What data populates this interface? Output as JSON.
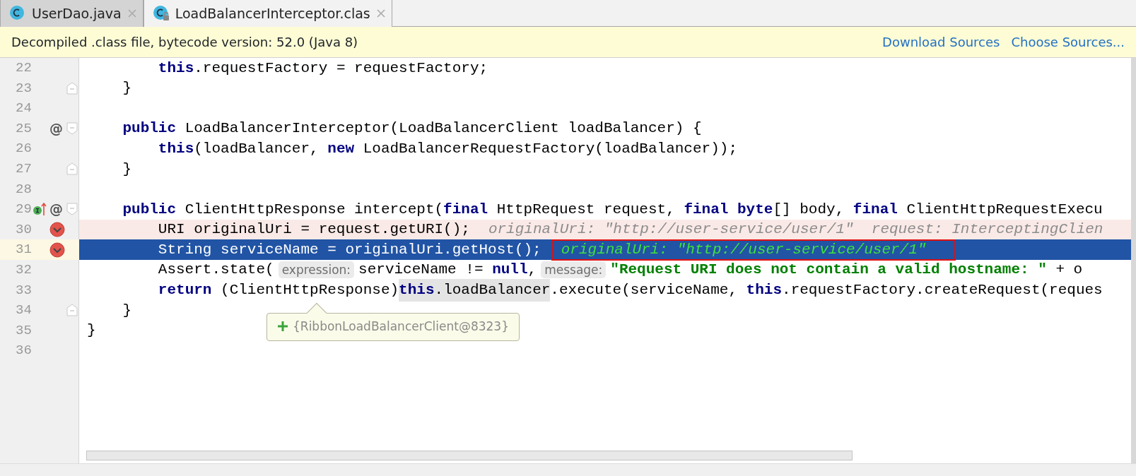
{
  "tabs": [
    {
      "label": "UserDao.java",
      "selected": false,
      "locked": false
    },
    {
      "label": "LoadBalancerInterceptor.clas",
      "selected": true,
      "locked": true
    }
  ],
  "banner": {
    "message": "Decompiled .class file, bytecode version: 52.0 (Java 8)",
    "links": [
      "Download Sources",
      "Choose Sources..."
    ]
  },
  "lines": [
    {
      "number": "22",
      "implements": false,
      "breakpoint": false,
      "current": false,
      "tokens": [
        {
          "kind": "code",
          "text": "        **this**.requestFactory = requestFactory;"
        }
      ]
    },
    {
      "number": "23",
      "fold": {
        "kind": "end"
      },
      "implements": false,
      "breakpoint": false,
      "current": false,
      "tokens": [
        {
          "kind": "code",
          "text": "    }"
        }
      ]
    },
    {
      "number": "24",
      "implements": false,
      "breakpoint": false,
      "current": false
    },
    {
      "number": "25",
      "fold": {
        "kind": "start"
      },
      "annotation": "@",
      "implements": false,
      "breakpoint": false,
      "current": false,
      "tokens": [
        {
          "kind": "code",
          "text": "    **public** LoadBalancerInterceptor(LoadBalancerClient loadBalancer) {"
        }
      ]
    },
    {
      "number": "26",
      "implements": false,
      "breakpoint": false,
      "current": false,
      "tokens": [
        {
          "kind": "code",
          "text": "        **this**(loadBalancer, **new** LoadBalancerRequestFactory(loadBalancer));"
        }
      ]
    },
    {
      "number": "27",
      "fold": {
        "kind": "end"
      },
      "implements": false,
      "breakpoint": false,
      "current": false,
      "tokens": [
        {
          "kind": "code",
          "text": "    }"
        }
      ]
    },
    {
      "number": "28",
      "implements": false,
      "breakpoint": false,
      "current": false
    },
    {
      "number": "29",
      "fold": {
        "kind": "start"
      },
      "annotation": "@",
      "implements": true,
      "breakpoint": false,
      "current": false,
      "tokens": [
        {
          "kind": "code",
          "text": "    **public** ClientHttpResponse intercept(**final** HttpRequest request, **final** **byte**[] body, **final** ClientHttpRequestExecu"
        }
      ]
    },
    {
      "number": "30",
      "implements": false,
      "breakpoint": true,
      "current": false,
      "tokens": [
        {
          "kind": "code",
          "text": "        URI originalUri = request.getURI();"
        },
        {
          "kind": "value",
          "text": "originalUri: \"http://user-service/user/1\"  request: InterceptingClien"
        }
      ]
    },
    {
      "number": "31",
      "implements": false,
      "breakpoint": true,
      "current": true,
      "tokens": [
        {
          "kind": "code",
          "text": "        String serviceName = originalUri.getHost();"
        },
        {
          "kind": "value_boxed",
          "text": "originalUri: \"http://user-service/user/1\""
        }
      ]
    },
    {
      "number": "32",
      "implements": false,
      "breakpoint": false,
      "current": false,
      "tokens": [
        {
          "kind": "code",
          "text": "        Assert.state("
        },
        {
          "kind": "inlay",
          "text": "expression:"
        },
        {
          "kind": "code",
          "text": "serviceName != **null**,"
        },
        {
          "kind": "inlay",
          "text": "message:"
        },
        {
          "kind": "string",
          "text": "\"Request URI does not contain a valid hostname: \""
        },
        {
          "kind": "code",
          "text": " + o"
        }
      ]
    },
    {
      "number": "33",
      "implements": false,
      "breakpoint": false,
      "current": false,
      "tokens": [
        {
          "kind": "code",
          "text": "        **return** (ClientHttpResponse)"
        },
        {
          "kind": "highlight",
          "text": "**this**.loadBalancer"
        },
        {
          "kind": "code",
          "text": ".execute(serviceName, **this**.requestFactory.createRequest(reques"
        }
      ]
    },
    {
      "number": "34",
      "fold": {
        "kind": "end"
      },
      "implements": false,
      "breakpoint": false,
      "current": false,
      "tokens": [
        {
          "kind": "code",
          "text": "    }"
        }
      ]
    },
    {
      "number": "35",
      "implements": false,
      "breakpoint": false,
      "current": false,
      "tokens": [
        {
          "kind": "code",
          "text": "}"
        }
      ]
    },
    {
      "number": "36",
      "implements": false,
      "breakpoint": false,
      "current": false
    }
  ],
  "tooltip": {
    "text": "{RibbonLoadBalancerClient@8323}"
  }
}
